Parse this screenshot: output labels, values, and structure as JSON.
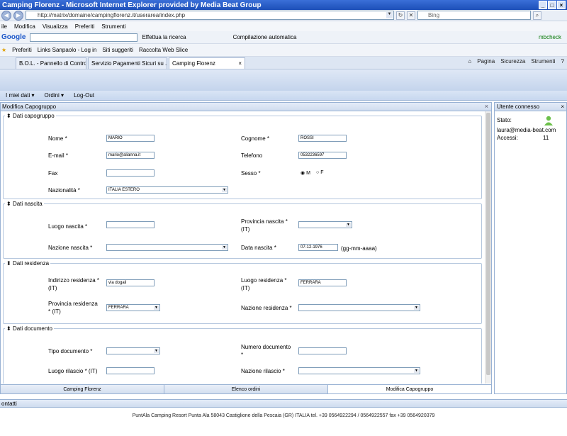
{
  "window": {
    "title": "Camping Florenz - Microsoft Internet Explorer provided by Media Beat Group"
  },
  "address": {
    "url": "http://matrix/domaine/campingflorenz.it/userarea/index.php",
    "search_placeholder": "Bing"
  },
  "menu": [
    "ile",
    "Modifica",
    "Visualizza",
    "Preferiti",
    "Strumenti"
  ],
  "toolbar": {
    "google": "Google",
    "search_btn": "Effettua la ricerca",
    "autofill": "Compilazione automatica",
    "user": "mbcheck"
  },
  "favorites": {
    "label": "Preferiti",
    "items": [
      "Links Sanpaolo - Log in",
      "Siti suggeriti",
      "Raccolta Web Slice"
    ]
  },
  "tabs": [
    "B.O.L. - Pannello di Controllo",
    "Servizio Pagamenti Sicuri su ...",
    "Camping Florenz"
  ],
  "commands": [
    "Pagina",
    "Sicurezza",
    "Strumenti"
  ],
  "appmenu": [
    "I miei dati",
    "Ordini",
    "Log-Out"
  ],
  "panel": {
    "title": "Modifica Capogruppo"
  },
  "sections": {
    "capogruppo": {
      "legend": "Dati capogruppo",
      "nome_label": "Nome *",
      "nome_value": "MARIO",
      "cognome_label": "Cognome *",
      "cognome_value": "ROSSI",
      "email_label": "E-mail *",
      "email_value": "mario@alianna.it",
      "telefono_label": "Telefono",
      "telefono_value": "0532236597",
      "fax_label": "Fax",
      "sesso_label": "Sesso *",
      "sesso_m": "M",
      "sesso_f": "F",
      "naz_label": "Nazionalità *",
      "naz_value": "ITALIA ESTERO"
    },
    "nascita": {
      "legend": "Dati nascita",
      "luogo_label": "Luogo nascita *",
      "prov_label": "Provincia nascita *",
      "prov_label2": "(IT)",
      "naz_label": "Nazione nascita *",
      "data_label": "Data nascita *",
      "data_value": "07-12-1976",
      "data_hint": "(gg-mm-aaaa)"
    },
    "residenza": {
      "legend": "Dati residenza",
      "ind_label": "Indirizzo residenza *",
      "ind_label2": "(IT)",
      "ind_value": "via dogali",
      "luogo_label": "Luogo residenza *",
      "luogo_label2": "(IT)",
      "luogo_value": "FERRARA",
      "prov_label": "Provincia residenza",
      "prov_label2": "* (IT)",
      "prov_value": "FERRARA",
      "naz_label": "Nazione residenza *"
    },
    "documento": {
      "legend": "Dati documento",
      "tipo_label": "Tipo documento *",
      "num_label": "Numero documento",
      "num_label2": "*",
      "luogo_label": "Luogo rilascio * (IT)",
      "naz_label": "Nazione rilascio *"
    }
  },
  "bottom_tabs": [
    "Camping Florenz",
    "Elenco ordini",
    "Modifica Capogruppo"
  ],
  "side": {
    "title": "Utente connesso",
    "stato_label": "Stato:",
    "email": "laura@media-beat.com",
    "accessi_label": "Accessi:",
    "accessi_value": "11"
  },
  "contatti": {
    "title": "ontatti"
  },
  "footer": {
    "text": "PuntAla Camping Resort Punta Ala 58043 Castiglione della Pescaia (GR) ITALIA tel. +39 0564922294 / 0564922557 fax +39 0564920379"
  }
}
